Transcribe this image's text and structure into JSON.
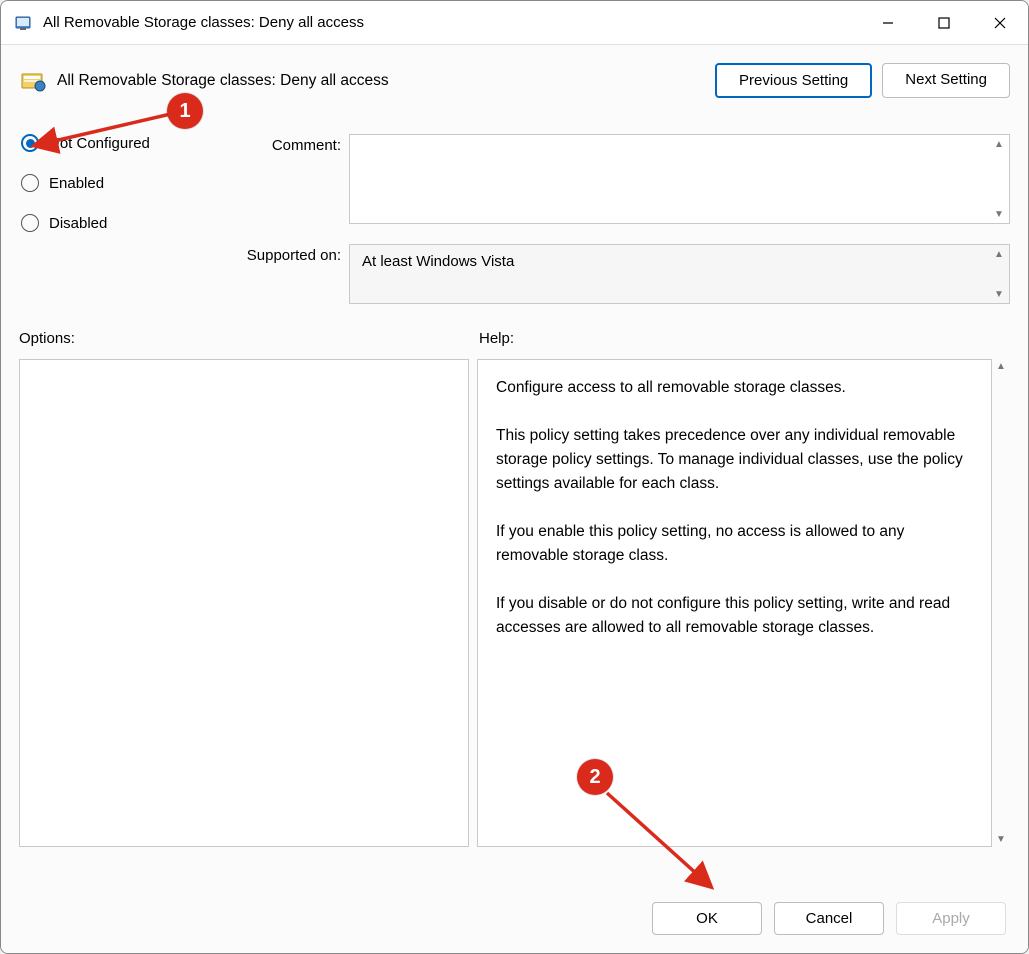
{
  "window": {
    "title": "All Removable Storage classes: Deny all access"
  },
  "setting": {
    "title": "All Removable Storage classes: Deny all access"
  },
  "nav": {
    "prev": "Previous Setting",
    "next": "Next Setting"
  },
  "radios": {
    "not_configured": "Not Configured",
    "enabled": "Enabled",
    "disabled": "Disabled",
    "selected": "not_configured"
  },
  "fields": {
    "comment_label": "Comment:",
    "comment_value": "",
    "supported_label": "Supported on:",
    "supported_value": "At least Windows Vista"
  },
  "panels": {
    "options_label": "Options:",
    "help_label": "Help:"
  },
  "help_text": "Configure access to all removable storage classes.\n\nThis policy setting takes precedence over any individual removable storage policy settings. To manage individual classes, use the policy settings available for each class.\n\nIf you enable this policy setting, no access is allowed to any removable storage class.\n\nIf you disable or do not configure this policy setting, write and read accesses are allowed to all removable storage classes.",
  "footer": {
    "ok": "OK",
    "cancel": "Cancel",
    "apply": "Apply"
  },
  "annotations": {
    "marker1": "1",
    "marker2": "2"
  }
}
